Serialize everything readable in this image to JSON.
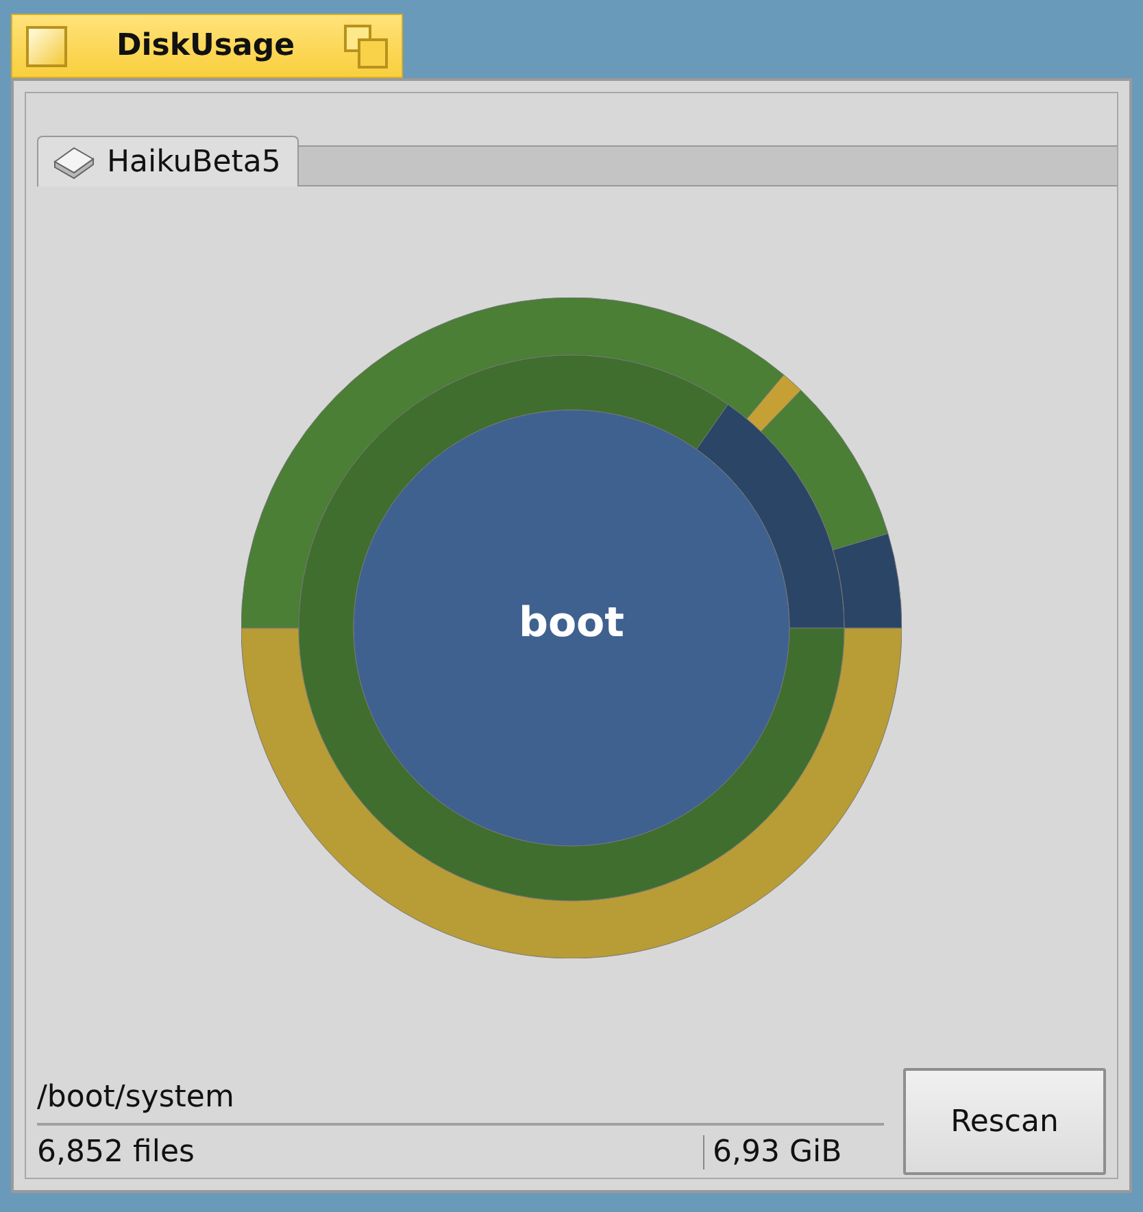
{
  "window": {
    "title": "DiskUsage"
  },
  "tabs": [
    {
      "label": "HaikuBeta5",
      "selected": true
    }
  ],
  "chart": {
    "center_label": "boot"
  },
  "status": {
    "path": "/boot/system",
    "files": "6,852 files",
    "size": "6,93 GiB"
  },
  "buttons": [
    {
      "label": "Rescan"
    }
  ]
}
